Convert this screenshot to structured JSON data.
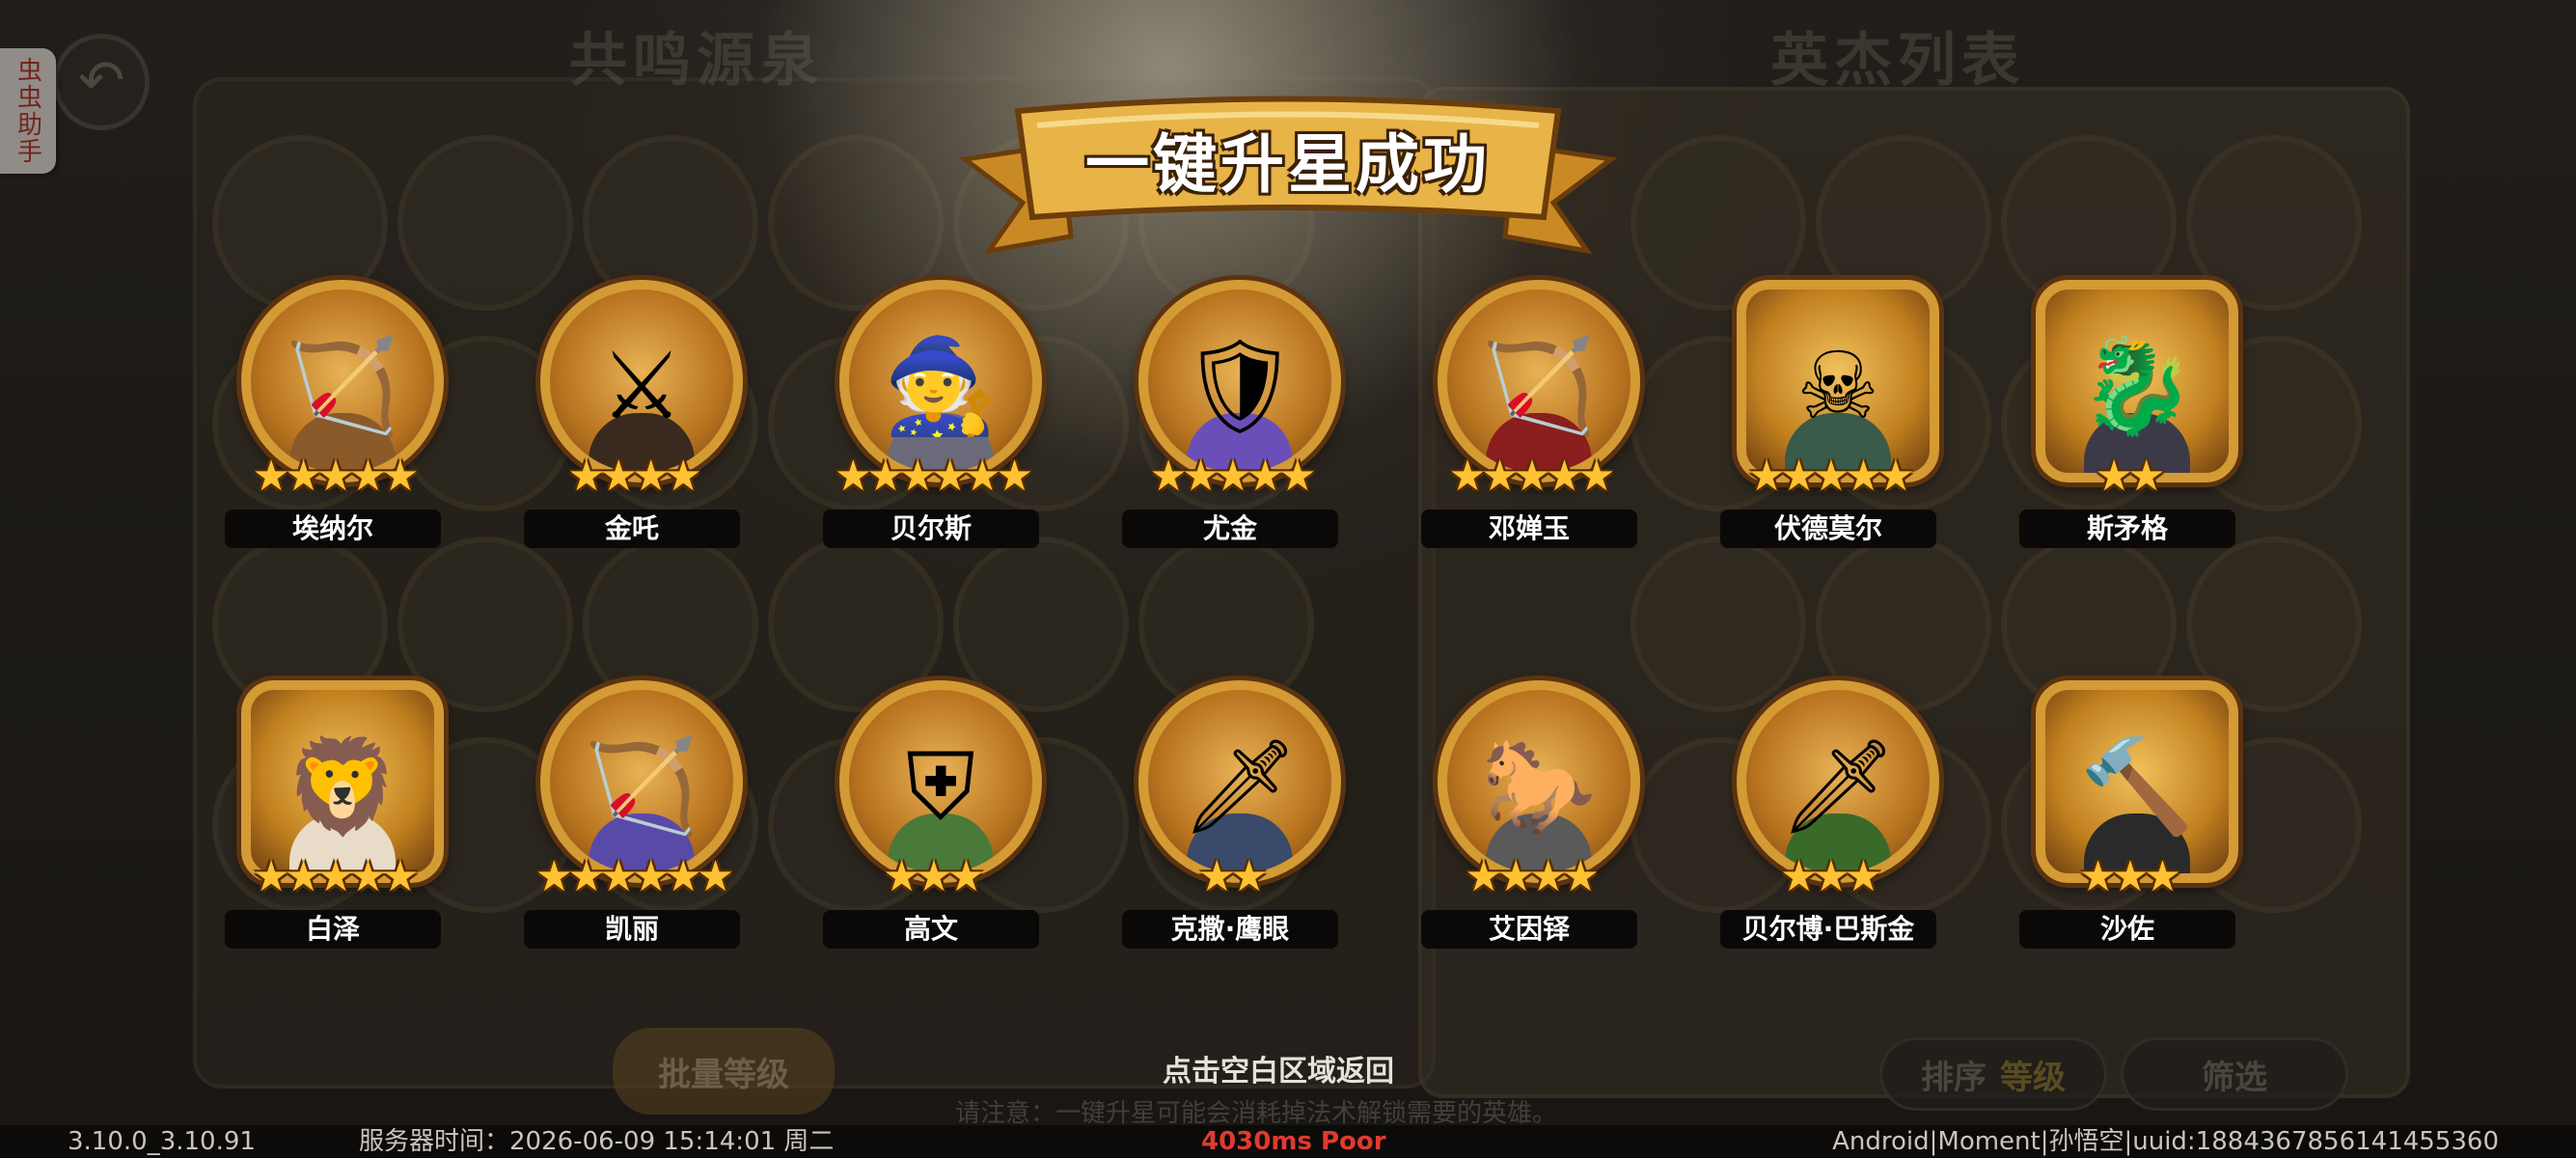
{
  "background": {
    "left_panel_title": "共鸣源泉",
    "right_panel_title": "英杰列表",
    "back_icon": "back-arrow-icon",
    "batch_button": "批量等级",
    "sort_label": "排序",
    "sort_value": "等级",
    "filter_label": "筛选",
    "note": "请注意：一键升星可能会消耗掉法术解锁需要的英雄。"
  },
  "side_tab": {
    "label": "虫虫助手"
  },
  "banner": {
    "title": "一键升星成功"
  },
  "heroes_row1": [
    {
      "name": "埃纳尔",
      "stars": "★★★★★",
      "color": "#8a5a2b",
      "icon": "archer-rider-icon"
    },
    {
      "name": "金吒",
      "stars": "★★★★",
      "color": "#3a2a1e",
      "icon": "swordsman-icon"
    },
    {
      "name": "贝尔斯",
      "stars": "★★★★★★",
      "color": "#6a6a7a",
      "icon": "wizard-icon"
    },
    {
      "name": "尤金",
      "stars": "★★★★★",
      "color": "#6b4fb8",
      "icon": "knight-icon"
    },
    {
      "name": "邓婵玉",
      "stars": "★★★★★",
      "color": "#8b1e1e",
      "icon": "archer-girl-icon"
    },
    {
      "name": "伏德莫尔",
      "stars": "★★★★★",
      "color": "#3a5a4a",
      "icon": "necromancer-icon"
    },
    {
      "name": "斯矛格",
      "stars": "★★",
      "color": "#3d3a48",
      "icon": "dragon-icon"
    }
  ],
  "heroes_row2": [
    {
      "name": "白泽",
      "stars": "★★★★★",
      "color": "#e8dcc8",
      "icon": "beast-icon"
    },
    {
      "name": "凯丽",
      "stars": "★★★★★★",
      "color": "#5a4aa8",
      "icon": "elf-archer-icon"
    },
    {
      "name": "高文",
      "stars": "★★★",
      "color": "#4a7a3a",
      "icon": "green-knight-icon"
    },
    {
      "name": "克撒·鹰眼",
      "stars": "★★",
      "color": "#3a4a6a",
      "icon": "hunter-icon"
    },
    {
      "name": "艾因铎",
      "stars": "★★★★",
      "color": "#5a5a5a",
      "icon": "cavalry-icon"
    },
    {
      "name": "贝尔博·巴斯金",
      "stars": "★★★",
      "color": "#3a6a2a",
      "icon": "halfling-icon"
    },
    {
      "name": "沙佐",
      "stars": "★★★",
      "color": "#2a2a2a",
      "icon": "hammer-knight-icon"
    }
  ],
  "return_hint": "点击空白区域返回",
  "status": {
    "version": "3.10.0_3.10.91",
    "server_time_label": "服务器时间：",
    "server_time": "2026-06-09  15:14:01  周二",
    "latency": "4030ms Poor",
    "device": "Android|Moment|孙悟空|uuid:1884367856141455360"
  },
  "colors": {
    "star": "#ffc233",
    "banner": "#e8b448",
    "latency_bad": "#e13a2f"
  }
}
